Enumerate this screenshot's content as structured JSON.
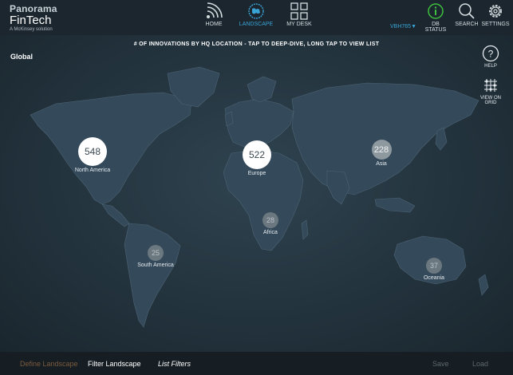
{
  "brand": {
    "line1": "Panorama",
    "line2": "FinTech",
    "line3": "A McKinsey solution"
  },
  "nav": [
    {
      "label": "HOME",
      "icon": "wifi-signal-icon"
    },
    {
      "label": "LANDSCAPE",
      "icon": "globe-icon",
      "active": true
    },
    {
      "label": "MY DESK",
      "icon": "grid-icon"
    }
  ],
  "right_nav": {
    "user": "VBH765▼",
    "db_status": "DB STATUS",
    "search": "SEARCH",
    "settings": "SETTINGS"
  },
  "map": {
    "title": "# OF INNOVATIONS BY HQ LOCATION - TAP TO DEEP-DIVE, LONG TAP TO VIEW LIST",
    "scope": "Global",
    "help_label": "HELP",
    "grid_label_1": "VIEW ON",
    "grid_label_2": "GRID",
    "regions": [
      {
        "name": "North America",
        "value": "548",
        "size": "big"
      },
      {
        "name": "Europe",
        "value": "522",
        "size": "big"
      },
      {
        "name": "Asia",
        "value": "228",
        "size": "mid"
      },
      {
        "name": "Africa",
        "value": "28",
        "size": "small"
      },
      {
        "name": "South America",
        "value": "25",
        "size": "small"
      },
      {
        "name": "Oceania",
        "value": "37",
        "size": "small"
      }
    ]
  },
  "bottom": {
    "define": "Define Landscape",
    "filter": "Filter Landscape",
    "list": "List Filters",
    "save": "Save",
    "load": "Load"
  },
  "colors": {
    "accent": "#3aa3d6",
    "status_green": "#3fbf3f",
    "map_bg": "#23333d",
    "land": "#34495a"
  }
}
